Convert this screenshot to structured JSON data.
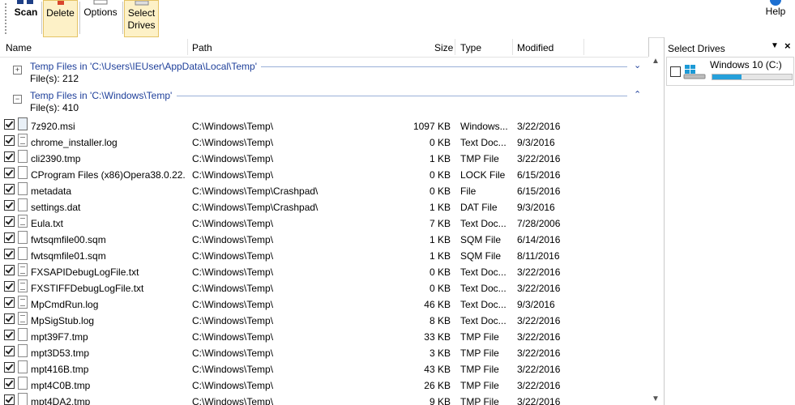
{
  "toolbar": {
    "scan_label": "Scan",
    "delete_label": "Delete",
    "options_label": "Options",
    "select_label_1": "Select",
    "select_label_2": "Drives",
    "help_label": "Help"
  },
  "columns": {
    "name": "Name",
    "path": "Path",
    "size": "Size",
    "type": "Type",
    "modified": "Modified"
  },
  "groups": [
    {
      "title": "Temp Files in 'C:\\Users\\IEUser\\AppData\\Local\\Temp'",
      "count": "File(s): 212",
      "toggle": "+",
      "chevron": "⌄"
    },
    {
      "title": "Temp Files in 'C:\\Windows\\Temp'",
      "count": "File(s): 410",
      "toggle": "−",
      "chevron": "⌃"
    }
  ],
  "files": [
    {
      "name": "7z920.msi",
      "path": "C:\\Windows\\Temp\\",
      "size": "1097 KB",
      "type": "Windows...",
      "modified": "3/22/2016",
      "icon": "installer-icon"
    },
    {
      "name": "chrome_installer.log",
      "path": "C:\\Windows\\Temp\\",
      "size": "0 KB",
      "type": "Text Doc...",
      "modified": "9/3/2016",
      "icon": "text-file-icon"
    },
    {
      "name": "cli2390.tmp",
      "path": "C:\\Windows\\Temp\\",
      "size": "1 KB",
      "type": "TMP File",
      "modified": "3/22/2016",
      "icon": "file-icon"
    },
    {
      "name": "CProgram Files (x86)Opera38.0.22...",
      "path": "C:\\Windows\\Temp\\",
      "size": "0 KB",
      "type": "LOCK File",
      "modified": "6/15/2016",
      "icon": "file-icon"
    },
    {
      "name": "metadata",
      "path": "C:\\Windows\\Temp\\Crashpad\\",
      "size": "0 KB",
      "type": "File",
      "modified": "6/15/2016",
      "icon": "file-icon"
    },
    {
      "name": "settings.dat",
      "path": "C:\\Windows\\Temp\\Crashpad\\",
      "size": "1 KB",
      "type": "DAT File",
      "modified": "9/3/2016",
      "icon": "file-icon"
    },
    {
      "name": "Eula.txt",
      "path": "C:\\Windows\\Temp\\",
      "size": "7 KB",
      "type": "Text Doc...",
      "modified": "7/28/2006",
      "icon": "text-file-icon"
    },
    {
      "name": "fwtsqmfile00.sqm",
      "path": "C:\\Windows\\Temp\\",
      "size": "1 KB",
      "type": "SQM File",
      "modified": "6/14/2016",
      "icon": "file-icon"
    },
    {
      "name": "fwtsqmfile01.sqm",
      "path": "C:\\Windows\\Temp\\",
      "size": "1 KB",
      "type": "SQM File",
      "modified": "8/11/2016",
      "icon": "file-icon"
    },
    {
      "name": "FXSAPIDebugLogFile.txt",
      "path": "C:\\Windows\\Temp\\",
      "size": "0 KB",
      "type": "Text Doc...",
      "modified": "3/22/2016",
      "icon": "text-file-icon"
    },
    {
      "name": "FXSTIFFDebugLogFile.txt",
      "path": "C:\\Windows\\Temp\\",
      "size": "0 KB",
      "type": "Text Doc...",
      "modified": "3/22/2016",
      "icon": "text-file-icon"
    },
    {
      "name": "MpCmdRun.log",
      "path": "C:\\Windows\\Temp\\",
      "size": "46 KB",
      "type": "Text Doc...",
      "modified": "9/3/2016",
      "icon": "text-file-icon"
    },
    {
      "name": "MpSigStub.log",
      "path": "C:\\Windows\\Temp\\",
      "size": "8 KB",
      "type": "Text Doc...",
      "modified": "3/22/2016",
      "icon": "text-file-icon"
    },
    {
      "name": "mpt39F7.tmp",
      "path": "C:\\Windows\\Temp\\",
      "size": "33 KB",
      "type": "TMP File",
      "modified": "3/22/2016",
      "icon": "file-icon"
    },
    {
      "name": "mpt3D53.tmp",
      "path": "C:\\Windows\\Temp\\",
      "size": "3 KB",
      "type": "TMP File",
      "modified": "3/22/2016",
      "icon": "file-icon"
    },
    {
      "name": "mpt416B.tmp",
      "path": "C:\\Windows\\Temp\\",
      "size": "43 KB",
      "type": "TMP File",
      "modified": "3/22/2016",
      "icon": "file-icon"
    },
    {
      "name": "mpt4C0B.tmp",
      "path": "C:\\Windows\\Temp\\",
      "size": "26 KB",
      "type": "TMP File",
      "modified": "3/22/2016",
      "icon": "file-icon"
    },
    {
      "name": "mpt4DA2.tmp",
      "path": "C:\\Windows\\Temp\\",
      "size": "9 KB",
      "type": "TMP File",
      "modified": "3/22/2016",
      "icon": "file-icon"
    }
  ],
  "drives_panel": {
    "title": "Select Drives",
    "drive_name": "Windows 10 (C:)",
    "usage_fraction": 0.37,
    "accent": "#26a0da"
  }
}
